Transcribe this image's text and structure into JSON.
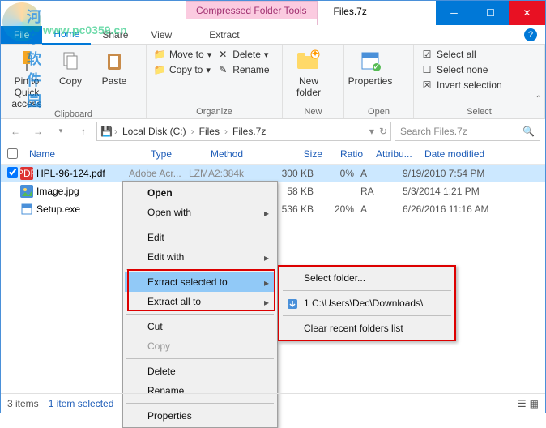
{
  "window": {
    "compressed_tools": "Compressed Folder Tools",
    "extract_tab": "Extract",
    "title": "Files.7z"
  },
  "ribbon_tabs": {
    "file": "File",
    "home": "Home",
    "share": "Share",
    "view": "View"
  },
  "ribbon": {
    "clipboard": {
      "label": "Clipboard",
      "pin": "Pin to Quick access",
      "copy": "Copy",
      "paste": "Paste"
    },
    "organize": {
      "label": "Organize",
      "moveto": "Move to",
      "copyto": "Copy to",
      "delete": "Delete",
      "rename": "Rename"
    },
    "new": {
      "label": "New",
      "newfolder": "New folder"
    },
    "open": {
      "label": "Open",
      "properties": "Properties"
    },
    "select": {
      "label": "Select",
      "selectall": "Select all",
      "selectnone": "Select none",
      "invert": "Invert selection"
    }
  },
  "breadcrumb": {
    "c1": "Local Disk (C:)",
    "c2": "Files",
    "c3": "Files.7z"
  },
  "search": {
    "placeholder": "Search Files.7z"
  },
  "columns": {
    "name": "Name",
    "type": "Type",
    "method": "Method",
    "size": "Size",
    "ratio": "Ratio",
    "attr": "Attribu...",
    "date": "Date modified"
  },
  "files": [
    {
      "name": "HPL-96-124.pdf",
      "type": "Adobe Acr...",
      "method": "LZMA2:384k",
      "size": "300 KB",
      "ratio": "0%",
      "attr": "A",
      "date": "9/19/2010 7:54 PM",
      "selected": true,
      "icon": "pdf"
    },
    {
      "name": "Image.jpg",
      "type": "",
      "method": "",
      "size": "58 KB",
      "ratio": "",
      "attr": "RA",
      "date": "5/3/2014 1:21 PM",
      "selected": false,
      "icon": "jpg"
    },
    {
      "name": "Setup.exe",
      "type": "",
      "method": "",
      "size": "536 KB",
      "ratio": "20%",
      "attr": "A",
      "date": "6/26/2016 11:16 AM",
      "selected": false,
      "icon": "exe"
    }
  ],
  "context1": {
    "open": "Open",
    "openwith": "Open with",
    "edit": "Edit",
    "editwith": "Edit with",
    "extractselected": "Extract selected to",
    "extractall": "Extract all to",
    "cut": "Cut",
    "copy": "Copy",
    "delete": "Delete",
    "rename": "Rename",
    "properties": "Properties"
  },
  "context2": {
    "selectfolder": "Select folder...",
    "recent1": "1 C:\\Users\\Dec\\Downloads\\",
    "clear": "Clear recent folders list"
  },
  "status": {
    "items": "3 items",
    "selected": "1 item selected"
  },
  "watermark": {
    "line1": "河东软件园",
    "line2": "www.pc0359.cn"
  }
}
